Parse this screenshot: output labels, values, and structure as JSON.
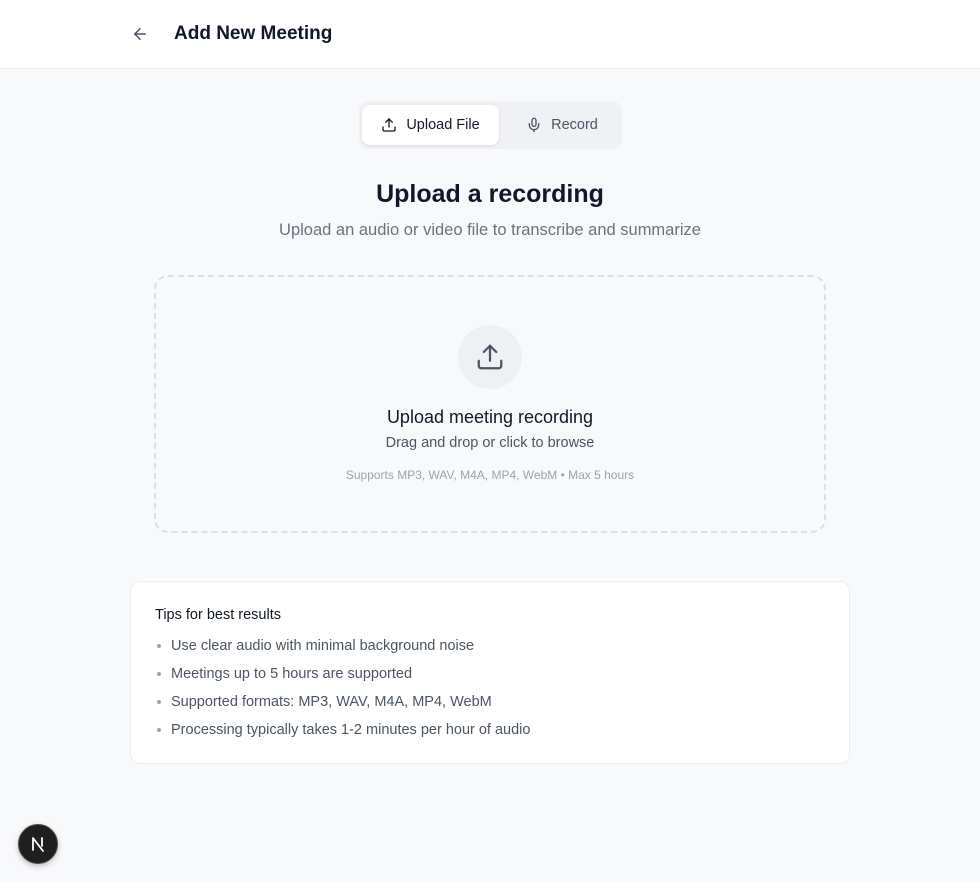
{
  "header": {
    "title": "Add New Meeting",
    "back_icon": "arrow-left-icon"
  },
  "mode_tabs": [
    {
      "label": "Upload File",
      "icon": "upload-icon",
      "active": true
    },
    {
      "label": "Record",
      "icon": "microphone-icon",
      "active": false
    }
  ],
  "main": {
    "heading": "Upload a recording",
    "subheading": "Upload an audio or video file to transcribe and summarize"
  },
  "dropzone": {
    "icon": "upload-icon",
    "title": "Upload meeting recording",
    "subtitle": "Drag and drop or click to browse",
    "note": "Supports MP3, WAV, M4A, MP4, WebM • Max 5 hours"
  },
  "tips": {
    "title": "Tips for best results",
    "items": [
      "Use clear audio with minimal background noise",
      "Meetings up to 5 hours are supported",
      "Supported formats: MP3, WAV, M4A, MP4, WebM",
      "Processing typically takes 1-2 minutes per hour of audio"
    ]
  },
  "fab": {
    "label": "N",
    "icon": "nextjs-logo-icon"
  },
  "colors": {
    "background": "#f8f9fb",
    "text_primary": "#111827",
    "text_secondary": "#4b5563",
    "text_muted": "#9ca3af",
    "fab": "#1f1f1f"
  }
}
